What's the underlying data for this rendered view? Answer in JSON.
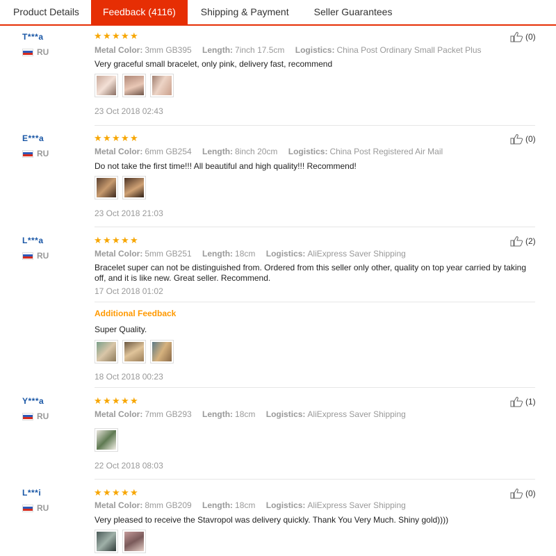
{
  "tabs": [
    {
      "label": "Product Details",
      "active": false
    },
    {
      "label": "Feedback (4116)",
      "active": true
    },
    {
      "label": "Shipping & Payment",
      "active": false
    },
    {
      "label": "Seller Guarantees",
      "active": false
    }
  ],
  "labels": {
    "metal_color": "Metal Color:",
    "length": "Length:",
    "logistics": "Logistics:",
    "additional_feedback": "Additional Feedback"
  },
  "colors": {
    "accent": "#e62e04",
    "star": "#f7a600",
    "username": "#1a57a6",
    "additional": "#ff9900"
  },
  "reviews": [
    {
      "user": "T***a",
      "country": "RU",
      "stars": 5,
      "metal_color": "3mm GB395",
      "length": "7inch 17.5cm",
      "logistics": "China Post Ordinary Small Packet Plus",
      "text": "Very graceful small bracelet, only pink, delivery fast, recommend",
      "date": "23 Oct 2018 02:43",
      "likes": "(0)"
    },
    {
      "user": "E***a",
      "country": "RU",
      "stars": 5,
      "metal_color": "6mm GB254",
      "length": "8inch 20cm",
      "logistics": "China Post Registered Air Mail",
      "text": "Do not take the first time!!! All beautiful and high quality!!! Recommend!",
      "date": "23 Oct 2018 21:03",
      "likes": "(0)"
    },
    {
      "user": "L***a",
      "country": "RU",
      "stars": 5,
      "metal_color": "5mm GB251",
      "length": "18cm",
      "logistics": "AliExpress Saver Shipping",
      "text": "Bracelet super can not be distinguished from. Ordered from this seller only other, quality on top year carried by taking off, and it is like new. Great seller. Recommend.",
      "date": "17 Oct 2018 01:02",
      "likes": "(2)",
      "additional_text": "Super Quality.",
      "additional_date": "18 Oct 2018 00:23"
    },
    {
      "user": "Y***a",
      "country": "RU",
      "stars": 5,
      "metal_color": "7mm GB293",
      "length": "18cm",
      "logistics": "AliExpress Saver Shipping",
      "text": "",
      "date": "22 Oct 2018 08:03",
      "likes": "(1)"
    },
    {
      "user": "L***i",
      "country": "RU",
      "stars": 5,
      "metal_color": "8mm GB209",
      "length": "18cm",
      "logistics": "AliExpress Saver Shipping",
      "text": "Very pleased to receive the Stavropol was delivery quickly. Thank You Very Much. Shiny gold))))",
      "date": "",
      "likes": "(0)"
    }
  ]
}
